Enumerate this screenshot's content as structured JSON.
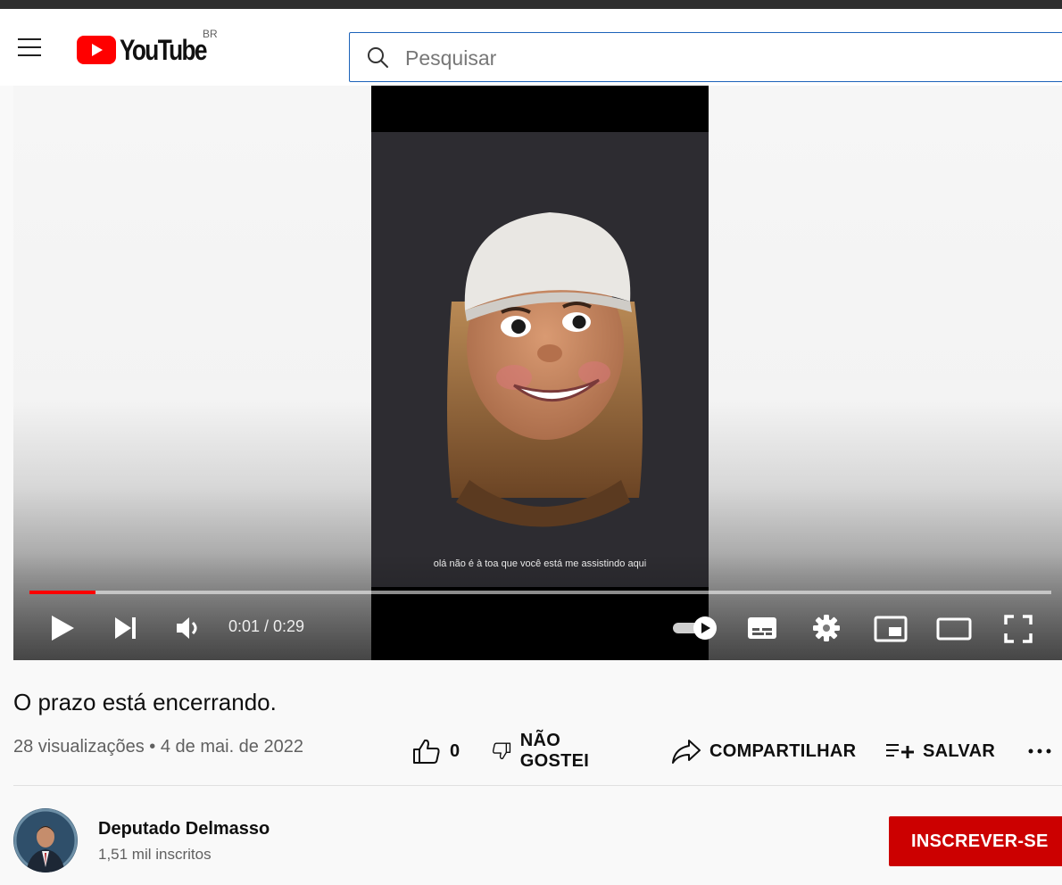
{
  "header": {
    "logo_text": "YouTube",
    "region": "BR",
    "search_placeholder": "Pesquisar"
  },
  "player": {
    "time": "0:01 / 0:29",
    "progress_fraction": 0.065,
    "subtitle": "olá não é à toa que você está me assistindo aqui"
  },
  "video": {
    "title": "O prazo está encerrando.",
    "meta": "28 visualizações • 4 de mai. de 2022"
  },
  "actions": {
    "like_count": "0",
    "dislike_label": "NÃO GOSTEI",
    "share_label": "COMPARTILHAR",
    "save_label": "SALVAR"
  },
  "channel": {
    "name": "Deputado Delmasso",
    "subscribers": "1,51 mil inscritos",
    "subscribe_label": "INSCREVER-SE"
  },
  "colors": {
    "brand_red": "#ff0000",
    "subscribe_red": "#cc0000",
    "search_border": "#1c62b9"
  }
}
